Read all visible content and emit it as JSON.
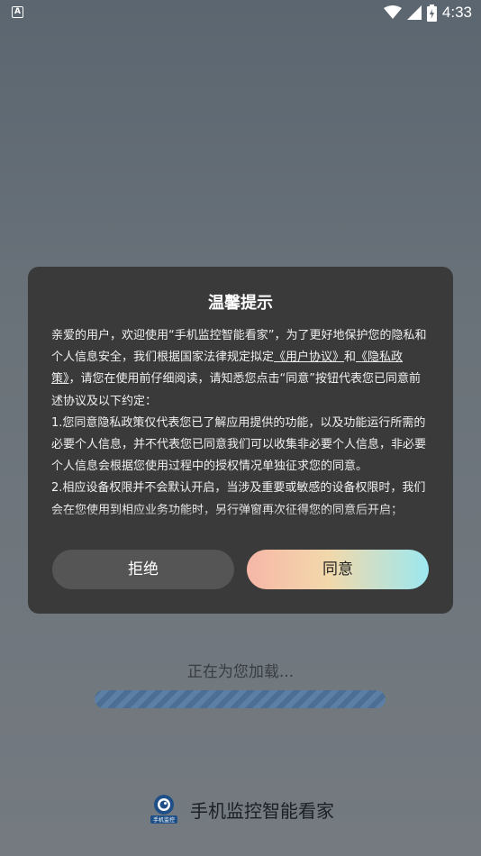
{
  "status_bar": {
    "left_icon": "A",
    "time": "4:33",
    "icons": [
      "wifi-icon",
      "signal-icon",
      "battery-icon"
    ]
  },
  "dialog": {
    "title": "温馨提示",
    "body": {
      "intro_1": "亲爱的用户，欢迎使用“手机监控智能看家”，为了更好地保护您的隐私和个人信息安全，我们根据国家法律规定拟定",
      "link_user_agreement": "《用户协议》",
      "and": "和",
      "link_privacy_policy": "《隐私政策》",
      "intro_2": "，请您在使用前仔细阅读，请知悉您点击“同意”按钮代表您已同意前述协议及以下约定：",
      "item_1": "1.您同意隐私政策仅代表您已了解应用提供的功能，以及功能运行所需的必要个人信息，并不代表您已同意我们可以收集非必要个人信息，非必要个人信息会根据您使用过程中的授权情况单独征求您的同意。",
      "item_2": "2.相应设备权限并不会默认开启，当涉及重要或敏感的设备权限时，我们会在您使用到相应业务功能时，另行弹窗再次征得您的同意后开启；"
    },
    "reject_label": "拒绝",
    "agree_label": "同意",
    "agree_gradient": [
      "#f7b7a7",
      "#f2d8ab",
      "#9ce8f0"
    ]
  },
  "loading": {
    "text": "正在为您加载..."
  },
  "brand": {
    "name": "手机监控智能看家",
    "logo_caption": "手机监控"
  }
}
